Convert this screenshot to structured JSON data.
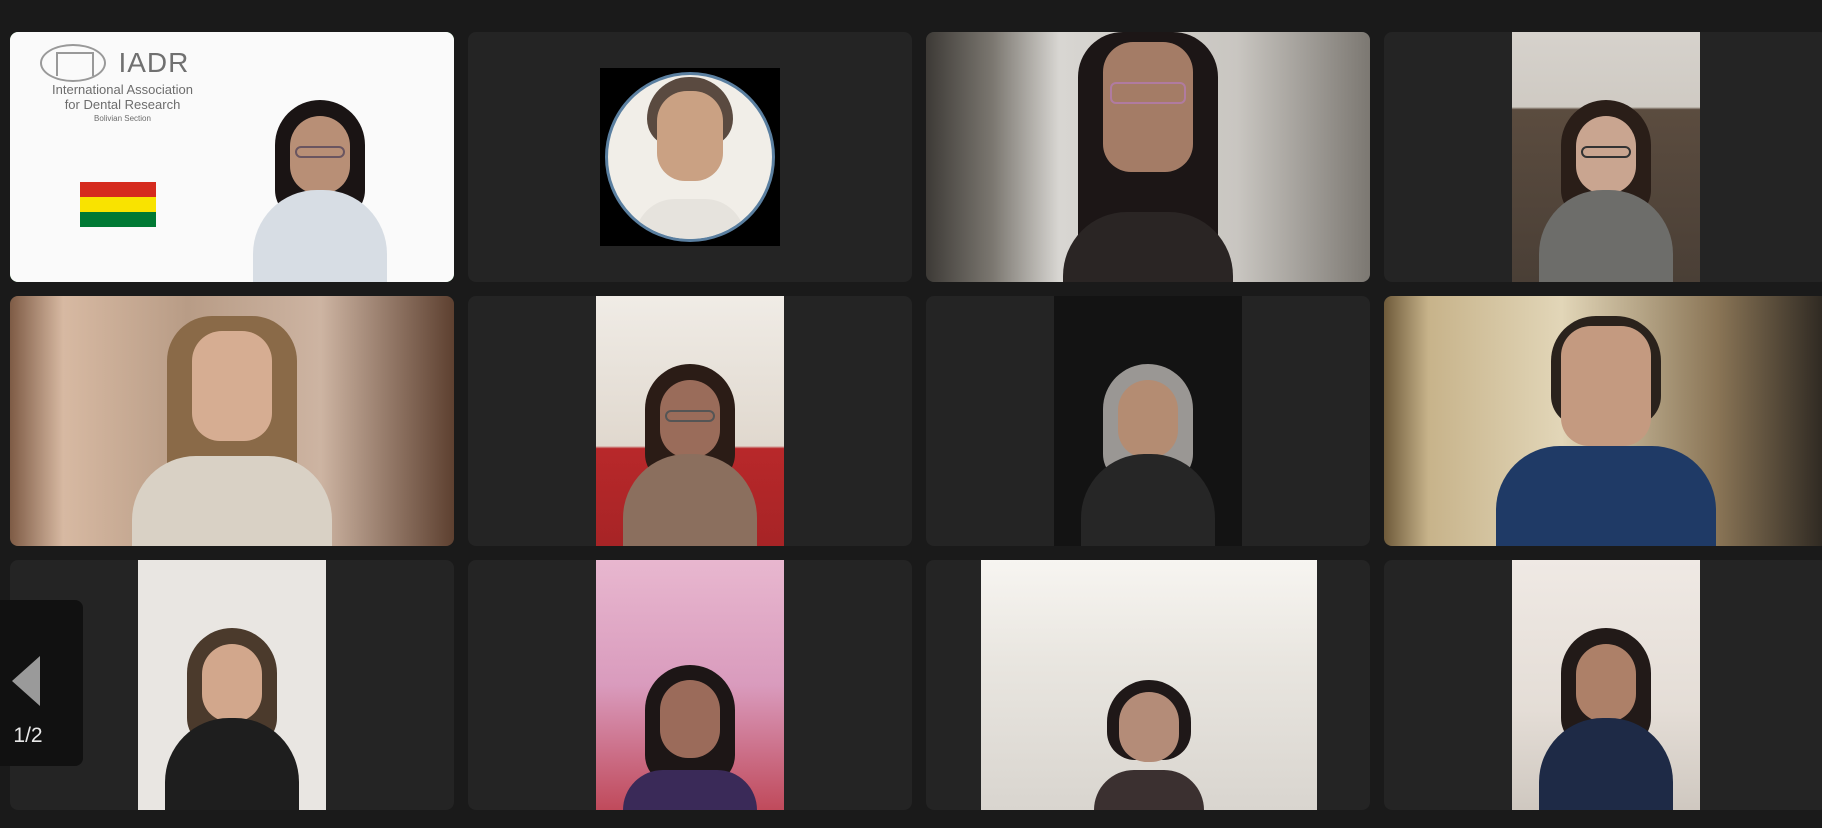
{
  "meeting": {
    "page_indicator": "1/2"
  },
  "logo": {
    "abbr": "IADR",
    "line1": "International Association",
    "line2": "for Dental Research",
    "section": "Bolivian Section"
  },
  "colors": {
    "active_speaker_border": "#3bb54a",
    "tile_background": "#242424",
    "app_background": "#1a1a1a",
    "flag_red": "#d52b1e",
    "flag_yellow": "#f9e300",
    "flag_green": "#007934"
  },
  "icons": {
    "previous_page": "triangle-left"
  }
}
